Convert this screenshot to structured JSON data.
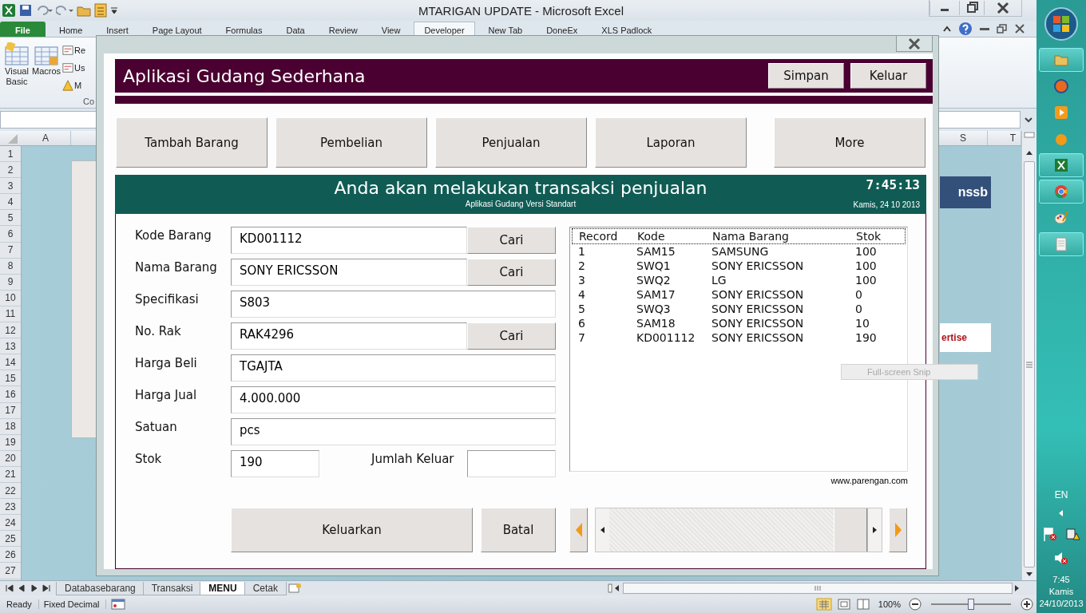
{
  "excel": {
    "title": "MTARIGAN UPDATE - Microsoft Excel",
    "ribbon_tabs": [
      {
        "label": "File",
        "kind": "file",
        "selected": false
      },
      {
        "label": "Home",
        "kind": "tab",
        "selected": false
      },
      {
        "label": "Insert",
        "kind": "tab",
        "selected": false
      },
      {
        "label": "Page Layout",
        "kind": "tab",
        "selected": false
      },
      {
        "label": "Formulas",
        "kind": "tab",
        "selected": false
      },
      {
        "label": "Data",
        "kind": "tab",
        "selected": false
      },
      {
        "label": "Review",
        "kind": "tab",
        "selected": false
      },
      {
        "label": "View",
        "kind": "tab",
        "selected": false
      },
      {
        "label": "Developer",
        "kind": "tab",
        "selected": true
      },
      {
        "label": "New Tab",
        "kind": "tab",
        "selected": false
      },
      {
        "label": "DoneEx",
        "kind": "tab",
        "selected": false
      },
      {
        "label": "XLS Padlock",
        "kind": "tab",
        "selected": false
      }
    ],
    "ribbon_large": [
      "Visual\nBasic",
      "Macros"
    ],
    "ribbon_small": [
      "Re",
      "Us",
      "M"
    ],
    "ribbon_group": "Co",
    "columns": [
      "A",
      "S",
      "T"
    ],
    "rows": [
      "1",
      "2",
      "3",
      "4",
      "5",
      "6",
      "7",
      "8",
      "9",
      "10",
      "11",
      "12",
      "13",
      "14",
      "15",
      "16",
      "17",
      "18",
      "19",
      "20",
      "21",
      "22",
      "23",
      "24",
      "25",
      "26",
      "27"
    ],
    "sheet_texts": {
      "banner": "nssb",
      "note": "ertise"
    },
    "sheet_tabs": [
      {
        "label": "Databasebarang",
        "selected": false
      },
      {
        "label": "Transaksi",
        "selected": false
      },
      {
        "label": "MENU",
        "selected": true
      },
      {
        "label": "Cetak",
        "selected": false
      }
    ],
    "status": [
      "Ready",
      "Fixed Decimal"
    ],
    "zoom": {
      "reading": "100%",
      "level": 0.5
    }
  },
  "snip": "Full-screen Snip",
  "dialog": {
    "title": "Aplikasi Gudang Sederhana",
    "header_buttons": [
      "Simpan",
      "Keluar"
    ],
    "nav_buttons": [
      "Tambah Barang",
      "Pembelian",
      "Penjualan",
      "Laporan",
      "More"
    ],
    "banner": {
      "title": "Anda akan melakukan transaksi penjualan",
      "subtitle": "Aplikasi Gudang Versi Standart",
      "time": "7:45:13",
      "date": "Kamis, 24 10 2013"
    },
    "fields": [
      {
        "label": "Kode Barang",
        "value": "KD001112",
        "kind": "search",
        "button": "Cari"
      },
      {
        "label": "Nama Barang",
        "value": "SONY ERICSSON",
        "kind": "search",
        "button": "Cari"
      },
      {
        "label": "Specifikasi",
        "value": "S803",
        "kind": "plain"
      },
      {
        "label": "No. Rak",
        "value": "RAK4296",
        "kind": "search",
        "button": "Cari"
      },
      {
        "label": "Harga Beli",
        "value": "TGAJTA",
        "kind": "plain"
      },
      {
        "label": "Harga Jual",
        "value": "4.000.000",
        "kind": "plain"
      },
      {
        "label": "Satuan",
        "value": "pcs",
        "kind": "plain"
      }
    ],
    "stok": {
      "label": "Stok",
      "value": "190"
    },
    "jumlah_keluar": {
      "label": "Jumlah Keluar"
    },
    "list": {
      "columns": [
        "Record",
        "Kode",
        "Nama Barang",
        "Stok"
      ],
      "rows": [
        [
          "1",
          "SAM15",
          "SAMSUNG",
          "100"
        ],
        [
          "2",
          "SWQ1",
          "SONY ERICSSON",
          "100"
        ],
        [
          "3",
          "SWQ2",
          "LG",
          "100"
        ],
        [
          "4",
          "SAM17",
          "SONY ERICSSON",
          "0"
        ],
        [
          "5",
          "SWQ3",
          "SONY ERICSSON",
          "0"
        ],
        [
          "6",
          "SAM18",
          "SONY ERICSSON",
          "10"
        ],
        [
          "7",
          "KD001112",
          "SONY ERICSSON",
          "190"
        ]
      ]
    },
    "website": "www.parengan.com",
    "actions": [
      "Keluarkan",
      "Batal"
    ]
  },
  "taskbar": {
    "language": "EN",
    "time": "7:45",
    "day": "Kamis",
    "date": "24/10/2013"
  }
}
